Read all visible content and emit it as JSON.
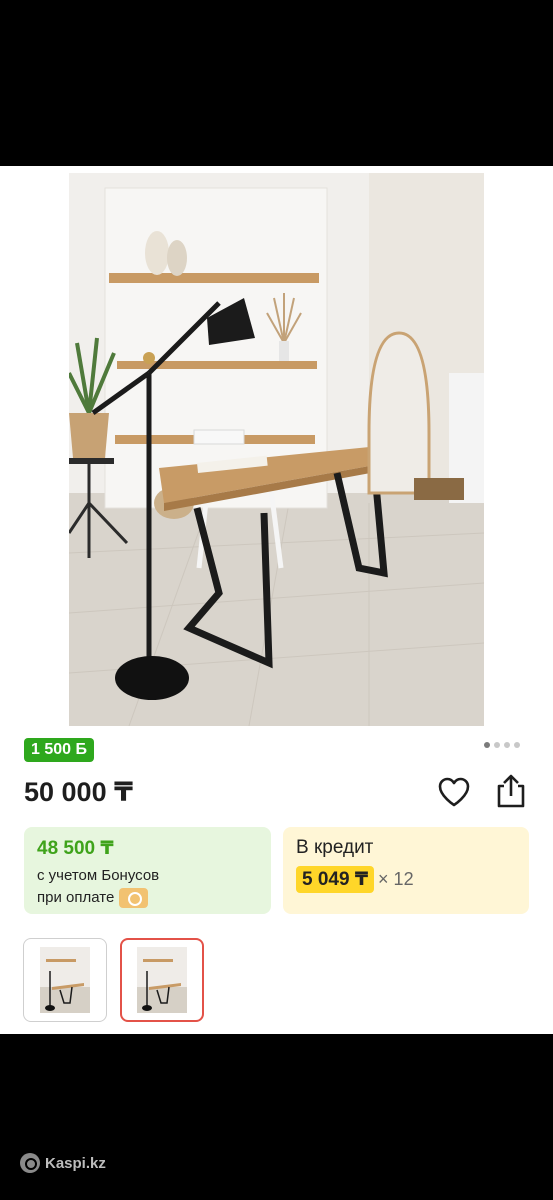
{
  "product": {
    "bonus_badge": "1 500 Б",
    "price": "50 000 ₸",
    "gallery": {
      "image_count": 4,
      "active_index": 0,
      "icon": "product-photo-desk-with-lamp"
    },
    "actions": {
      "favorite_icon": "heart-icon",
      "share_icon": "share-icon"
    }
  },
  "bonus_offer": {
    "price": "48 500 ₸",
    "line1": "с учетом Бонусов",
    "line2": "при оплате"
  },
  "credit_offer": {
    "label": "В кредит",
    "amount": "5 049 ₸",
    "multiplier": "× 12"
  },
  "thumbnails": [
    {
      "selected": false
    },
    {
      "selected": true
    }
  ],
  "watermark": {
    "text": "Kaspi.kz"
  },
  "colors": {
    "bonus_green": "#2ea81d",
    "credit_yellow": "#ffd629",
    "selected_red": "#e35248"
  }
}
